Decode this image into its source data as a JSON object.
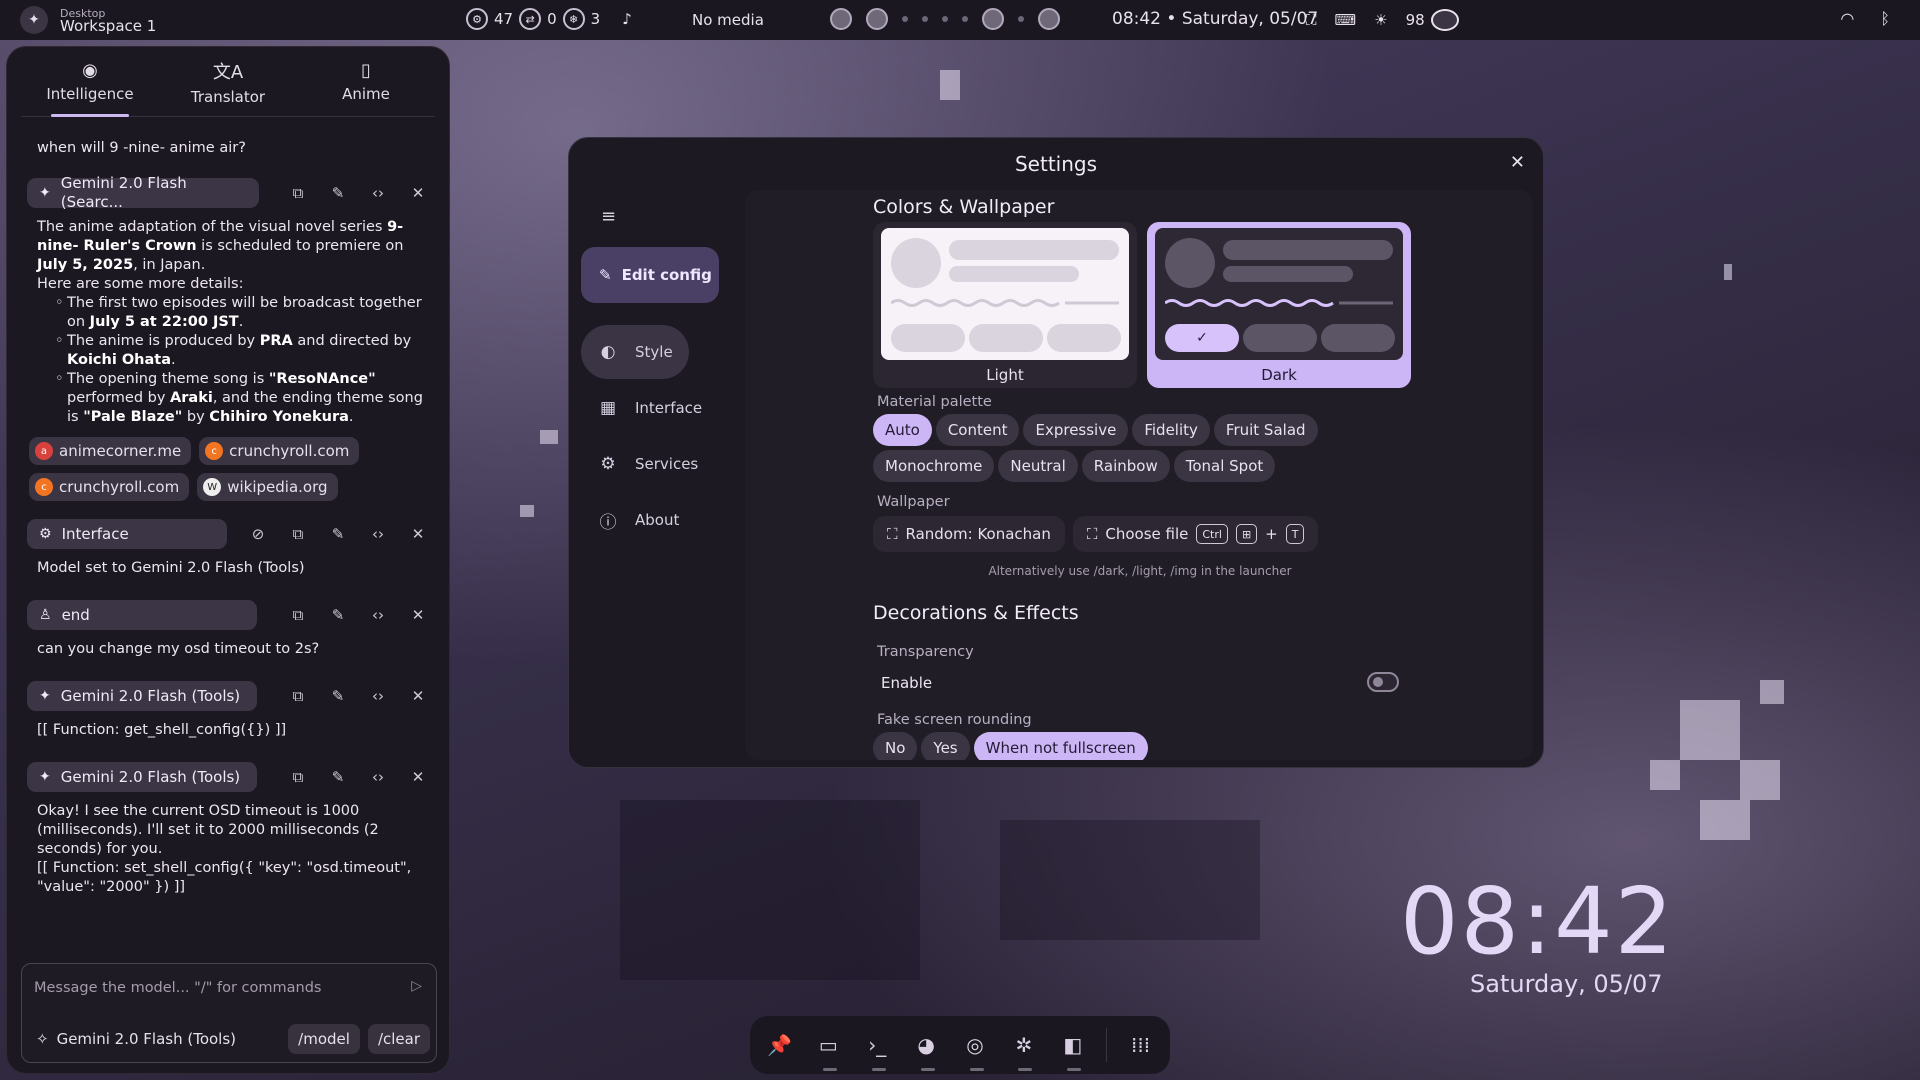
{
  "topbar": {
    "ws_small": "Desktop",
    "ws_big": "Workspace 1",
    "cpu": "47",
    "swap": "0",
    "temp": "3",
    "media": "No media",
    "clock": "08:42 • Saturday, 05/07",
    "battery": "98"
  },
  "sidebar": {
    "tabs": [
      {
        "label": "Intelligence",
        "icon": "brain-icon"
      },
      {
        "label": "Translator",
        "icon": "translate-icon"
      },
      {
        "label": "Anime",
        "icon": "bookmark-icon"
      }
    ],
    "q1": "when will 9 -nine- anime air?",
    "m1_model": "Gemini 2.0 Flash (Searc...",
    "m1_p1_a": "The anime adaptation of the visual novel series ",
    "m1_p1_b": "9-nine- Ruler's Crown",
    "m1_p1_c": " is scheduled to premiere on ",
    "m1_p1_d": "July 5, 2025",
    "m1_p1_e": ", in Japan.",
    "m1_p2": "Here are some more details:",
    "m1_li1_a": "The first two episodes will be broadcast together on ",
    "m1_li1_b": "July 5 at 22:00 JST",
    "m1_li1_c": ".",
    "m1_li2_a": "The anime is produced by ",
    "m1_li2_b": "PRA",
    "m1_li2_c": " and directed by ",
    "m1_li2_d": "Koichi Ohata",
    "m1_li2_e": ".",
    "m1_li3_a": "The opening theme song is ",
    "m1_li3_b": "\"ResoNAnce\"",
    "m1_li3_c": " performed by ",
    "m1_li3_d": "Araki",
    "m1_li3_e": ", and the ending theme song is ",
    "m1_li3_f": "\"Pale Blaze\"",
    "m1_li3_g": " by ",
    "m1_li3_h": "Chihiro Yonekura",
    "m1_li3_i": ".",
    "sources": [
      "animecorner.me",
      "crunchyroll.com",
      "crunchyroll.com",
      "wikipedia.org"
    ],
    "m2_role": "Interface",
    "m2_text": "Model set to Gemini 2.0 Flash (Tools)",
    "m3_role": "end",
    "m3_text": "can you change my osd timeout to 2s?",
    "m4_model": "Gemini 2.0 Flash (Tools)",
    "m4_text": "[[ Function: get_shell_config({}) ]]",
    "m5_model": "Gemini 2.0 Flash (Tools)",
    "m5_text": "Okay! I see the current OSD timeout is 1000 (milliseconds). I'll set it to 2000 milliseconds (2 seconds) for you.",
    "m5_text2": "[[ Function: set_shell_config({ \"key\": \"osd.timeout\", \"value\": \"2000\" }) ]]",
    "input_placeholder": "Message the model... \"/\" for commands",
    "current_model": "Gemini 2.0 Flash (Tools)",
    "btn_model": "/model",
    "btn_clear": "/clear"
  },
  "settings": {
    "title": "Settings",
    "edit_config": "Edit config",
    "nav": [
      "Style",
      "Interface",
      "Services",
      "About"
    ],
    "colors_title": "Colors & Wallpaper",
    "light": "Light",
    "dark": "Dark",
    "palette_label": "Material palette",
    "palettes_row1": [
      "Auto",
      "Content",
      "Expressive",
      "Fidelity",
      "Fruit Salad"
    ],
    "palettes_row2": [
      "Monochrome",
      "Neutral",
      "Rainbow",
      "Tonal Spot"
    ],
    "wallpaper_label": "Wallpaper",
    "random_btn": "Random: Konachan",
    "choose_btn": "Choose file",
    "kbd_ctrl": "Ctrl",
    "kbd_plus": "+",
    "kbd_t": "T",
    "hint": "Alternatively use /dark, /light, /img in the launcher",
    "deco_title": "Decorations & Effects",
    "transparency": "Transparency",
    "enable": "Enable",
    "rounding_label": "Fake screen rounding",
    "rounding": [
      "No",
      "Yes",
      "When not fullscreen"
    ]
  },
  "desktop": {
    "clock": "08:42",
    "date": "Saturday, 05/07"
  },
  "colors": {
    "accent": "#cdb6f5",
    "panel": "#1c1821"
  }
}
